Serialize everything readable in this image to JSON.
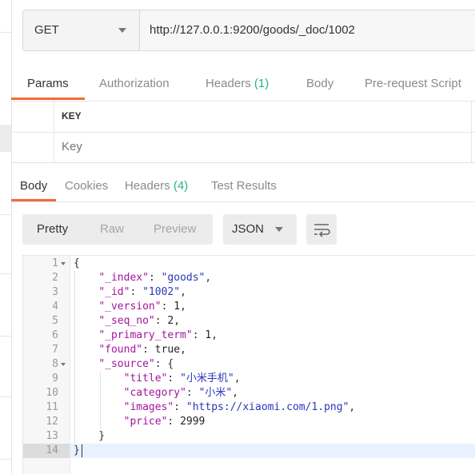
{
  "request": {
    "method": "GET",
    "url": "http://127.0.0.1:9200/goods/_doc/1002"
  },
  "request_tabs": [
    {
      "label": "Params"
    },
    {
      "label": "Authorization"
    },
    {
      "label": "Headers ",
      "count": "(1)"
    },
    {
      "label": "Body"
    },
    {
      "label": "Pre-request Script"
    }
  ],
  "params_table": {
    "key_header": "KEY",
    "key_placeholder": "Key"
  },
  "response_tabs": [
    {
      "label": "Body"
    },
    {
      "label": "Cookies"
    },
    {
      "label": "Headers ",
      "count": "(4)"
    },
    {
      "label": "Test Results"
    }
  ],
  "view_modes": [
    "Pretty",
    "Raw",
    "Preview"
  ],
  "format": "JSON",
  "icons": {
    "method_dropdown": "chevron-down-icon",
    "format_dropdown": "chevron-down-icon",
    "wrap": "wrap-lines-icon"
  },
  "colors": {
    "accent": "#f26b3a",
    "count": "#26b47f",
    "json_key": "#a3159c",
    "json_string": "#2a37b8"
  },
  "code_lines": [
    {
      "num": "1",
      "parts": [
        [
          "p",
          "{"
        ]
      ]
    },
    {
      "num": "2",
      "parts": [
        [
          "p",
          "    "
        ],
        [
          "k",
          "\"_index\""
        ],
        [
          "p",
          ": "
        ],
        [
          "s",
          "\"goods\""
        ],
        [
          "p",
          ","
        ]
      ]
    },
    {
      "num": "3",
      "parts": [
        [
          "p",
          "    "
        ],
        [
          "k",
          "\"_id\""
        ],
        [
          "p",
          ": "
        ],
        [
          "s",
          "\"1002\""
        ],
        [
          "p",
          ","
        ]
      ]
    },
    {
      "num": "4",
      "parts": [
        [
          "p",
          "    "
        ],
        [
          "k",
          "\"_version\""
        ],
        [
          "p",
          ": "
        ],
        [
          "n",
          "1"
        ],
        [
          "p",
          ","
        ]
      ]
    },
    {
      "num": "5",
      "parts": [
        [
          "p",
          "    "
        ],
        [
          "k",
          "\"_seq_no\""
        ],
        [
          "p",
          ": "
        ],
        [
          "n",
          "2"
        ],
        [
          "p",
          ","
        ]
      ]
    },
    {
      "num": "6",
      "parts": [
        [
          "p",
          "    "
        ],
        [
          "k",
          "\"_primary_term\""
        ],
        [
          "p",
          ": "
        ],
        [
          "n",
          "1"
        ],
        [
          "p",
          ","
        ]
      ]
    },
    {
      "num": "7",
      "parts": [
        [
          "p",
          "    "
        ],
        [
          "k",
          "\"found\""
        ],
        [
          "p",
          ": "
        ],
        [
          "n",
          "true"
        ],
        [
          "p",
          ","
        ]
      ]
    },
    {
      "num": "8",
      "parts": [
        [
          "p",
          "    "
        ],
        [
          "k",
          "\"_source\""
        ],
        [
          "p",
          ": {"
        ]
      ]
    },
    {
      "num": "9",
      "parts": [
        [
          "p",
          "        "
        ],
        [
          "k",
          "\"title\""
        ],
        [
          "p",
          ": "
        ],
        [
          "s",
          "\"小米手机\""
        ],
        [
          "p",
          ","
        ]
      ]
    },
    {
      "num": "10",
      "parts": [
        [
          "p",
          "        "
        ],
        [
          "k",
          "\"category\""
        ],
        [
          "p",
          ": "
        ],
        [
          "s",
          "\"小米\""
        ],
        [
          "p",
          ","
        ]
      ]
    },
    {
      "num": "11",
      "parts": [
        [
          "p",
          "        "
        ],
        [
          "k",
          "\"images\""
        ],
        [
          "p",
          ": "
        ],
        [
          "s",
          "\"https://xiaomi.com/1.png\""
        ],
        [
          "p",
          ","
        ]
      ]
    },
    {
      "num": "12",
      "parts": [
        [
          "p",
          "        "
        ],
        [
          "k",
          "\"price\""
        ],
        [
          "p",
          ": "
        ],
        [
          "n",
          "2999"
        ]
      ]
    },
    {
      "num": "13",
      "parts": [
        [
          "p",
          "    }"
        ]
      ]
    },
    {
      "num": "14",
      "parts": [
        [
          "p",
          "}"
        ]
      ]
    }
  ]
}
